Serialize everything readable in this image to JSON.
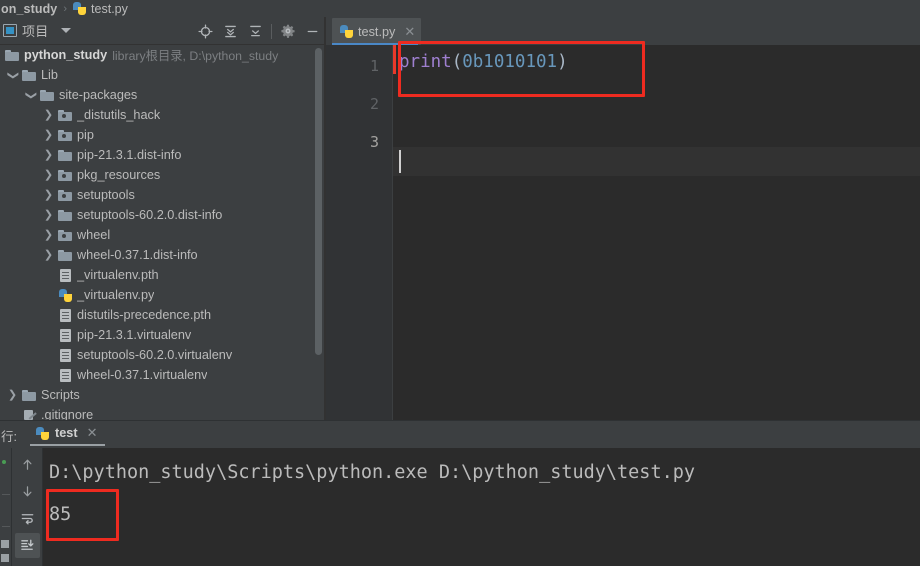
{
  "app": {
    "theme_bg": "#3c3f41",
    "editor_bg": "#2b2b2b",
    "accent_blue": "#4a88c7",
    "annotation_color": "#ee2b20"
  },
  "breadcrumb": {
    "project_fragment": "on_study",
    "separator": "›",
    "file": "test.py",
    "file_icon": "python-file-icon"
  },
  "project_panel": {
    "title": "项目",
    "panel_icon": "project-window-icon",
    "dropdown_icon": "chevron-down-icon",
    "tools": [
      {
        "name": "locate-in-tree-icon",
        "label": "Select Opened File"
      },
      {
        "name": "expand-all-icon",
        "label": "Expand All"
      },
      {
        "name": "collapse-all-icon",
        "label": "Collapse All"
      },
      {
        "name": "gear-icon",
        "label": "Settings"
      },
      {
        "name": "minimize-icon",
        "label": "Hide"
      }
    ],
    "tree": [
      {
        "label": "python_study",
        "note": "library根目录, D:\\python_study",
        "icon": "folder-icon",
        "indent": 0,
        "twisty": "none",
        "bold": true
      },
      {
        "label": "Lib",
        "note": "",
        "icon": "folder-icon",
        "indent": 1,
        "twisty": "down",
        "bold": false
      },
      {
        "label": "site-packages",
        "note": "",
        "icon": "folder-icon",
        "indent": 2,
        "twisty": "down",
        "bold": false
      },
      {
        "label": "_distutils_hack",
        "note": "",
        "icon": "package-folder-icon",
        "indent": 3,
        "twisty": "right",
        "bold": false
      },
      {
        "label": "pip",
        "note": "",
        "icon": "package-folder-icon",
        "indent": 3,
        "twisty": "right",
        "bold": false
      },
      {
        "label": "pip-21.3.1.dist-info",
        "note": "",
        "icon": "folder-icon",
        "indent": 3,
        "twisty": "right",
        "bold": false
      },
      {
        "label": "pkg_resources",
        "note": "",
        "icon": "package-folder-icon",
        "indent": 3,
        "twisty": "right",
        "bold": false
      },
      {
        "label": "setuptools",
        "note": "",
        "icon": "package-folder-icon",
        "indent": 3,
        "twisty": "right",
        "bold": false
      },
      {
        "label": "setuptools-60.2.0.dist-info",
        "note": "",
        "icon": "folder-icon",
        "indent": 3,
        "twisty": "right",
        "bold": false
      },
      {
        "label": "wheel",
        "note": "",
        "icon": "package-folder-icon",
        "indent": 3,
        "twisty": "right",
        "bold": false
      },
      {
        "label": "wheel-0.37.1.dist-info",
        "note": "",
        "icon": "folder-icon",
        "indent": 3,
        "twisty": "right",
        "bold": false
      },
      {
        "label": "_virtualenv.pth",
        "note": "",
        "icon": "text-file-icon",
        "indent": 4,
        "twisty": "none",
        "bold": false
      },
      {
        "label": "_virtualenv.py",
        "note": "",
        "icon": "python-file-icon",
        "indent": 4,
        "twisty": "none",
        "bold": false
      },
      {
        "label": "distutils-precedence.pth",
        "note": "",
        "icon": "text-file-icon",
        "indent": 4,
        "twisty": "none",
        "bold": false
      },
      {
        "label": "pip-21.3.1.virtualenv",
        "note": "",
        "icon": "text-file-icon",
        "indent": 4,
        "twisty": "none",
        "bold": false
      },
      {
        "label": "setuptools-60.2.0.virtualenv",
        "note": "",
        "icon": "text-file-icon",
        "indent": 4,
        "twisty": "none",
        "bold": false
      },
      {
        "label": "wheel-0.37.1.virtualenv",
        "note": "",
        "icon": "text-file-icon",
        "indent": 4,
        "twisty": "none",
        "bold": false
      },
      {
        "label": "Scripts",
        "note": "",
        "icon": "folder-icon",
        "indent": 1,
        "twisty": "right",
        "bold": false
      },
      {
        "label": ".gitignore",
        "note": "",
        "icon": "git-file-icon",
        "indent": 1,
        "twisty": "none",
        "bold": false
      }
    ]
  },
  "editor": {
    "tab": {
      "label": "test.py",
      "icon": "python-file-icon",
      "close_icon": "close-icon"
    },
    "line_numbers": [
      "1",
      "2",
      "3"
    ],
    "active_line": "3",
    "code": {
      "line1": {
        "func": "print",
        "open_paren": "(",
        "literal": "0b1010101",
        "close_paren": ")"
      },
      "func_color": "#9f7fd0",
      "literal_color": "#6897bb",
      "punct_color": "#a9b7c6"
    }
  },
  "run_panel": {
    "title": "行:",
    "tab": {
      "label": "test",
      "icon": "python-file-icon",
      "close_icon": "close-icon"
    },
    "toolbar": [
      {
        "name": "up-arrow-icon",
        "label": "Up the Stack Trace",
        "selected": false
      },
      {
        "name": "down-arrow-icon",
        "label": "Down the Stack Trace",
        "selected": false
      },
      {
        "name": "soft-wrap-icon",
        "label": "Soft-Wrap",
        "selected": false
      },
      {
        "name": "scroll-to-end-icon",
        "label": "Scroll to End",
        "selected": true
      }
    ],
    "console": {
      "command": "D:\\python_study\\Scripts\\python.exe D:\\python_study\\test.py",
      "output": "85"
    }
  },
  "annotations": [
    {
      "name": "code-highlight-box",
      "target": "print(0b1010101)"
    },
    {
      "name": "output-highlight-box",
      "target": "85"
    }
  ]
}
